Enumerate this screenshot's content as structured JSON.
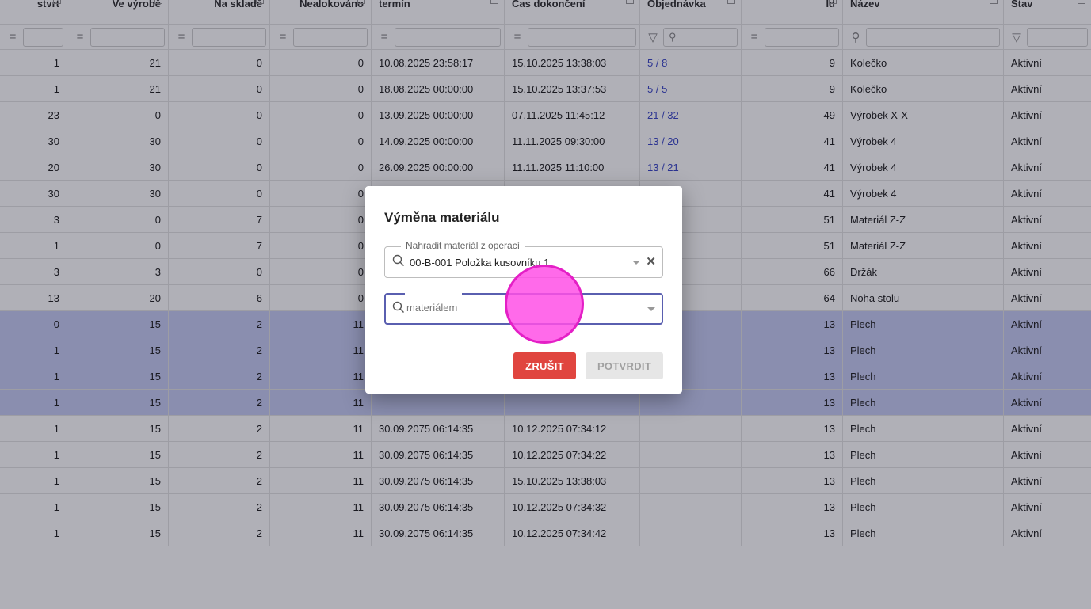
{
  "columns": [
    "stvrt",
    "Ve výrobě",
    "Na skladě",
    "Nealokováno",
    "termín",
    "Čas dokončení",
    "Objednávka",
    "Id",
    "Název",
    "Stav"
  ],
  "filters": [
    {
      "op": "="
    },
    {
      "op": "="
    },
    {
      "op": "="
    },
    {
      "op": "="
    },
    {
      "op": "="
    },
    {
      "op": "="
    },
    {
      "op": "filter-icon",
      "search": true
    },
    {
      "op": "="
    },
    {
      "op": "search-icon"
    },
    {
      "op": "filter-icon"
    }
  ],
  "rows": [
    {
      "c": [
        "1",
        "21",
        "0",
        "0",
        "10.08.2025 23:58:17",
        "15.10.2025 13:38:03",
        "5 / 8",
        "9",
        "Kolečko",
        "Aktivní"
      ],
      "selected": false
    },
    {
      "c": [
        "1",
        "21",
        "0",
        "0",
        "18.08.2025 00:00:00",
        "15.10.2025 13:37:53",
        "5 / 5",
        "9",
        "Kolečko",
        "Aktivní"
      ],
      "selected": false
    },
    {
      "c": [
        "23",
        "0",
        "0",
        "0",
        "13.09.2025 00:00:00",
        "07.11.2025 11:45:12",
        "21 / 32",
        "49",
        "Výrobek X-X",
        "Aktivní"
      ],
      "selected": false
    },
    {
      "c": [
        "30",
        "30",
        "0",
        "0",
        "14.09.2025 00:00:00",
        "11.11.2025 09:30:00",
        "13 / 20",
        "41",
        "Výrobek 4",
        "Aktivní"
      ],
      "selected": false
    },
    {
      "c": [
        "20",
        "30",
        "0",
        "0",
        "26.09.2025 00:00:00",
        "11.11.2025 11:10:00",
        "13 / 21",
        "41",
        "Výrobek 4",
        "Aktivní"
      ],
      "selected": false
    },
    {
      "c": [
        "30",
        "30",
        "0",
        "0",
        "",
        "",
        "",
        "41",
        "Výrobek 4",
        "Aktivní"
      ],
      "selected": false
    },
    {
      "c": [
        "3",
        "0",
        "7",
        "0",
        "",
        "",
        "",
        "51",
        "Materiál Z-Z",
        "Aktivní"
      ],
      "selected": false
    },
    {
      "c": [
        "1",
        "0",
        "7",
        "0",
        "",
        "",
        "",
        "51",
        "Materiál Z-Z",
        "Aktivní"
      ],
      "selected": false
    },
    {
      "c": [
        "3",
        "3",
        "0",
        "0",
        "",
        "",
        "",
        "66",
        "Držák",
        "Aktivní"
      ],
      "selected": false
    },
    {
      "c": [
        "13",
        "20",
        "6",
        "0",
        "",
        "",
        "",
        "64",
        "Noha stolu",
        "Aktivní"
      ],
      "selected": false
    },
    {
      "c": [
        "0",
        "15",
        "2",
        "11",
        "",
        "",
        "",
        "13",
        "Plech",
        "Aktivní"
      ],
      "selected": true
    },
    {
      "c": [
        "1",
        "15",
        "2",
        "11",
        "",
        "",
        "",
        "13",
        "Plech",
        "Aktivní"
      ],
      "selected": true
    },
    {
      "c": [
        "1",
        "15",
        "2",
        "11",
        "",
        "",
        "",
        "13",
        "Plech",
        "Aktivní"
      ],
      "selected": true
    },
    {
      "c": [
        "1",
        "15",
        "2",
        "11",
        "",
        "",
        "",
        "13",
        "Plech",
        "Aktivní"
      ],
      "selected": true
    },
    {
      "c": [
        "1",
        "15",
        "2",
        "11",
        "30.09.2075 06:14:35",
        "10.12.2025 07:34:12",
        "",
        "13",
        "Plech",
        "Aktivní"
      ],
      "selected": false
    },
    {
      "c": [
        "1",
        "15",
        "2",
        "11",
        "30.09.2075 06:14:35",
        "10.12.2025 07:34:22",
        "",
        "13",
        "Plech",
        "Aktivní"
      ],
      "selected": false
    },
    {
      "c": [
        "1",
        "15",
        "2",
        "11",
        "30.09.2075 06:14:35",
        "15.10.2025 13:38:03",
        "",
        "13",
        "Plech",
        "Aktivní"
      ],
      "selected": false
    },
    {
      "c": [
        "1",
        "15",
        "2",
        "11",
        "30.09.2075 06:14:35",
        "10.12.2025 07:34:32",
        "",
        "13",
        "Plech",
        "Aktivní"
      ],
      "selected": false
    },
    {
      "c": [
        "1",
        "15",
        "2",
        "11",
        "30.09.2075 06:14:35",
        "10.12.2025 07:34:42",
        "",
        "13",
        "Plech",
        "Aktivní"
      ],
      "selected": false
    }
  ],
  "dialog": {
    "title": "Výměna materiálu",
    "replace_label": "Nahradit materiál z operací",
    "replace_value": "00-B-001 Položka kusovníku 1",
    "with_placeholder": "materiálem",
    "cancel_label": "ZRUŠIT",
    "confirm_label": "POTVRDIT"
  },
  "colors": {
    "selected_row": "#c8cdf3",
    "link": "#3b48c8",
    "cancel": "#e0453f",
    "focus": "#5a5fb0",
    "touch": "#ff50e6"
  }
}
